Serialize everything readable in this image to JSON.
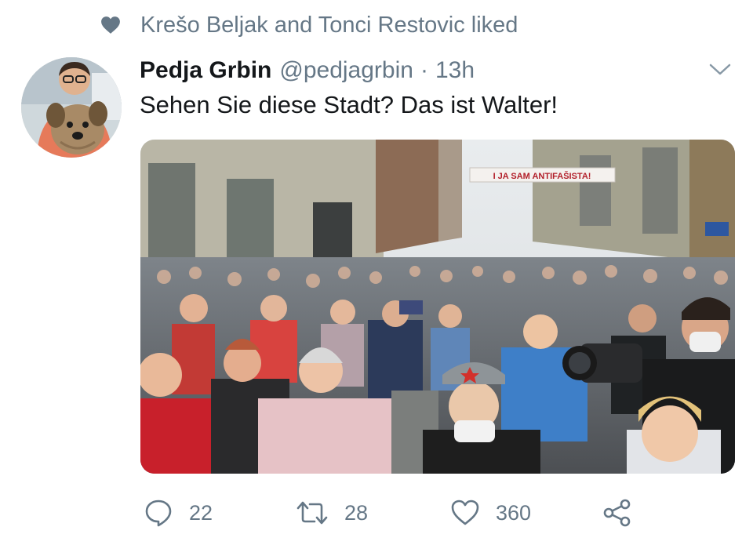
{
  "social_context": {
    "text": "Krešo Beljak and Tonci Restovic liked",
    "icon": "heart-icon"
  },
  "tweet": {
    "author_name": "Pedja Grbin",
    "author_handle": "@pedjagrbin",
    "separator": "·",
    "time": "13h",
    "text": "Sehen Sie diese Stadt? Das ist Walter!",
    "media": {
      "banner_text": "I JA SAM ANTIFAŠISTA!"
    }
  },
  "actions": {
    "reply_count": "22",
    "retweet_count": "28",
    "like_count": "360"
  },
  "colors": {
    "secondary_text": "#657786",
    "primary_text": "#14171a",
    "background": "#ffffff"
  }
}
